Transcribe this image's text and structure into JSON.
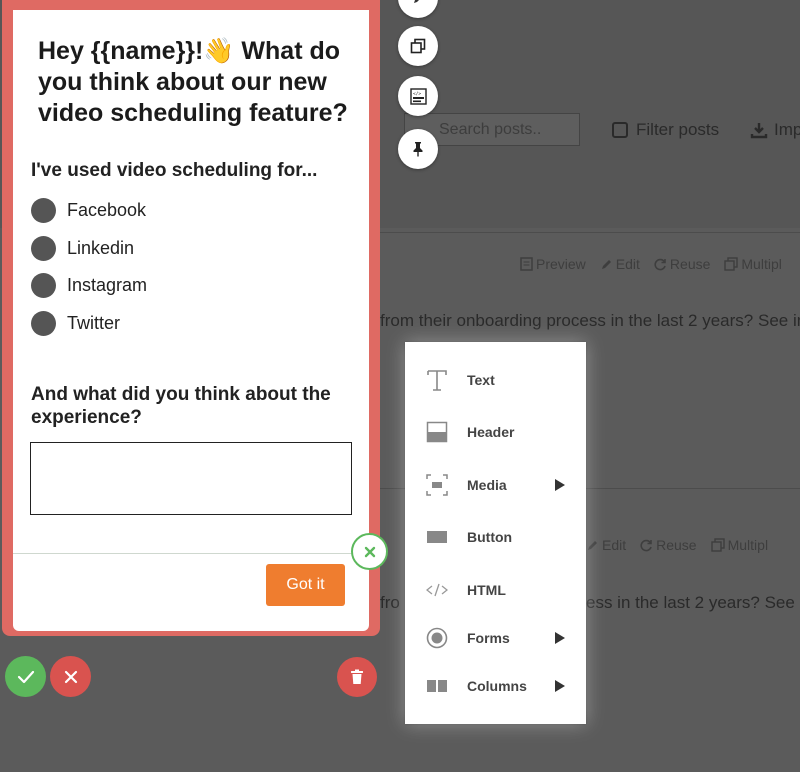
{
  "background": {
    "search_placeholder": "Search posts..",
    "filter_label": "Filter posts",
    "import_label": "Imp",
    "row_actions": {
      "preview": "Preview",
      "edit": "Edit",
      "reuse": "Reuse",
      "multiple": "Multipl"
    },
    "row1_text": "from their onboarding process in the last 2 years? See in",
    "row2_text_a": "fro",
    "row2_text_b": "ess in the last 2 years? See in"
  },
  "modal": {
    "title": "Hey {{name}}!👋 What do you think about our new video scheduling feature?",
    "question1": "I've used video scheduling for...",
    "options": [
      "Facebook",
      "Linkedin",
      "Instagram",
      "Twitter"
    ],
    "question2": "And what did you think about the experience?",
    "answer_value": "",
    "button_label": "Got it"
  },
  "picker": {
    "items": [
      {
        "label": "Text",
        "icon": "text-icon",
        "submenu": false
      },
      {
        "label": "Header",
        "icon": "header-icon",
        "submenu": false
      },
      {
        "label": "Media",
        "icon": "media-icon",
        "submenu": true
      },
      {
        "label": "Button",
        "icon": "button-icon",
        "submenu": false
      },
      {
        "label": "HTML",
        "icon": "html-icon",
        "submenu": false
      },
      {
        "label": "Forms",
        "icon": "forms-icon",
        "submenu": true
      },
      {
        "label": "Columns",
        "icon": "columns-icon",
        "submenu": true
      }
    ]
  },
  "colors": {
    "frame": "#df6a63",
    "button": "#ef7d2f",
    "confirm": "#5cb85c",
    "danger": "#d9534f"
  }
}
